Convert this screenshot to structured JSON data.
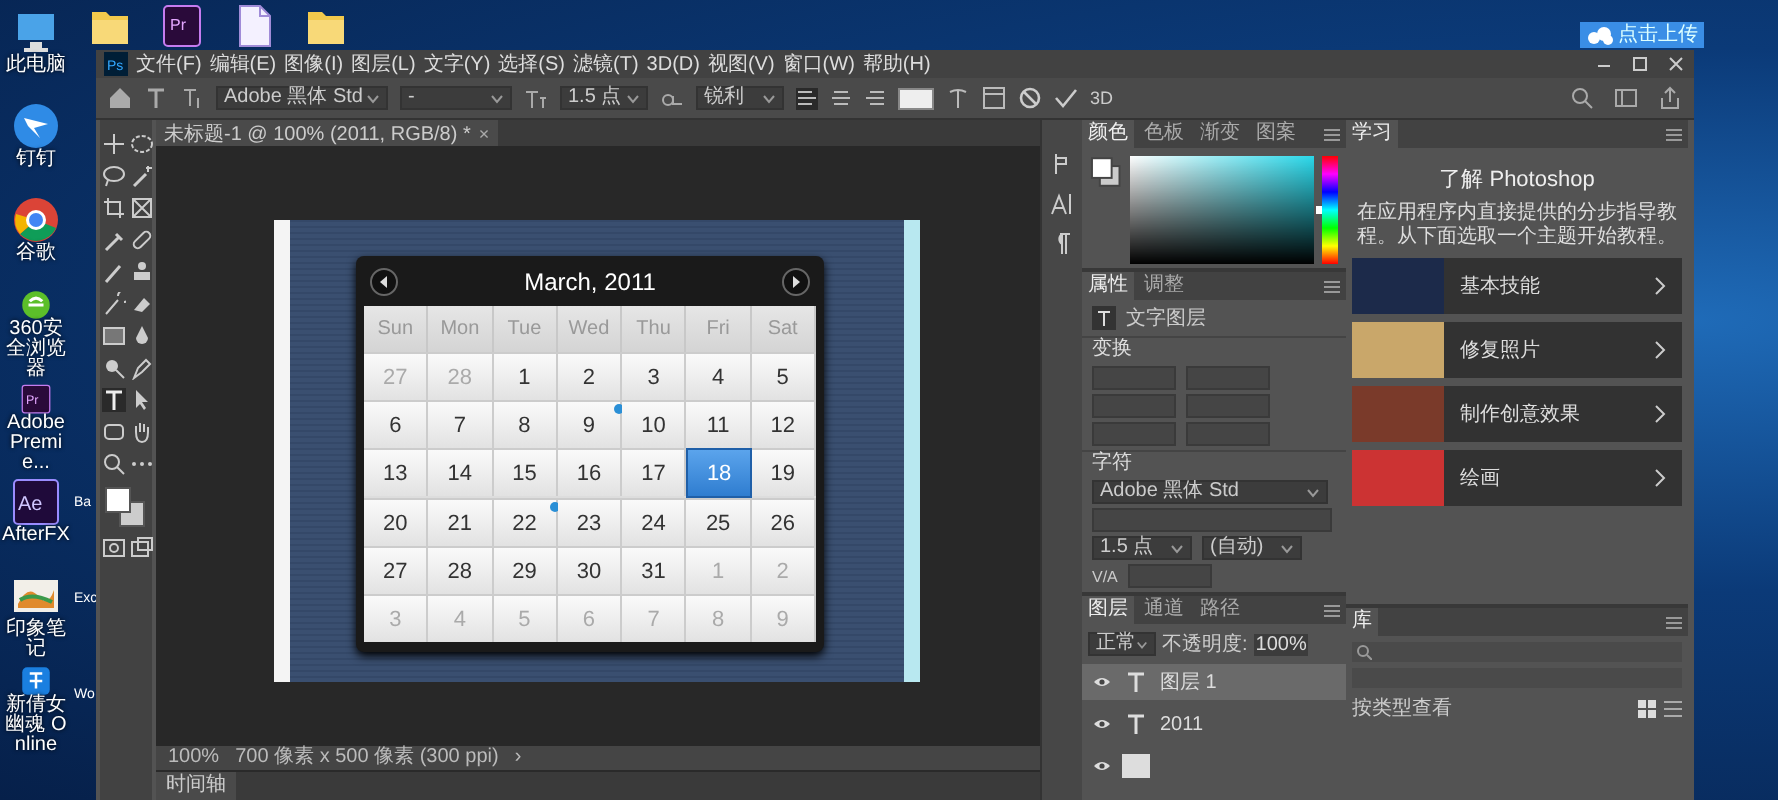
{
  "desktop": {
    "icons": [
      {
        "kind": "pc",
        "label": "此电脑"
      },
      {
        "kind": "dingtalk",
        "label": "钉钉"
      },
      {
        "kind": "chrome",
        "label": "谷歌"
      },
      {
        "kind": "browser360",
        "label": "360安全浏览器"
      },
      {
        "kind": "pr",
        "logo": "Pr",
        "label": "Adobe Premie..."
      },
      {
        "kind": "ae",
        "logo": "Ae",
        "label": "AfterFX"
      },
      {
        "kind": "notes",
        "label": "印象笔记"
      },
      {
        "kind": "game",
        "label": "新倩女幽魂 Online"
      }
    ],
    "partial_icons": [
      {
        "label": "Ba"
      },
      {
        "label": "Exc"
      },
      {
        "label": "Wo"
      }
    ],
    "top_icons": [
      {
        "kind": "folder"
      },
      {
        "kind": "prfile",
        "logo": "Pr"
      },
      {
        "kind": "document"
      },
      {
        "kind": "folder"
      }
    ],
    "upload_button": {
      "label": "点击上传"
    }
  },
  "photoshop": {
    "logo": "Ps",
    "menu": [
      "文件(F)",
      "编辑(E)",
      "图像(I)",
      "图层(L)",
      "文字(Y)",
      "选择(S)",
      "滤镜(T)",
      "3D(D)",
      "视图(V)",
      "窗口(W)",
      "帮助(H)"
    ],
    "options": {
      "font": "Adobe 黑体 Std",
      "style": "-",
      "size": "1.5 点",
      "antialias": "锐利",
      "three_d": "3D"
    },
    "document_tab": {
      "title": "未标题-1 @ 100% (2011, RGB/8) *",
      "close": "×"
    },
    "calendar": {
      "title": "March, 2011",
      "weekdays": [
        "Sun",
        "Mon",
        "Tue",
        "Wed",
        "Thu",
        "Fri",
        "Sat"
      ],
      "weeks": [
        [
          {
            "day": "27",
            "muted": true,
            "selected": false,
            "event": false
          },
          {
            "day": "28",
            "muted": true,
            "selected": false,
            "event": false
          },
          {
            "day": "1",
            "muted": false,
            "selected": false,
            "event": false
          },
          {
            "day": "2",
            "muted": false,
            "selected": false,
            "event": false
          },
          {
            "day": "3",
            "muted": false,
            "selected": false,
            "event": false
          },
          {
            "day": "4",
            "muted": false,
            "selected": false,
            "event": false
          },
          {
            "day": "5",
            "muted": false,
            "selected": false,
            "event": false
          }
        ],
        [
          {
            "day": "6",
            "muted": false,
            "selected": false,
            "event": false
          },
          {
            "day": "7",
            "muted": false,
            "selected": false,
            "event": false
          },
          {
            "day": "8",
            "muted": false,
            "selected": false,
            "event": false
          },
          {
            "day": "9",
            "muted": false,
            "selected": false,
            "event": true
          },
          {
            "day": "10",
            "muted": false,
            "selected": false,
            "event": false
          },
          {
            "day": "11",
            "muted": false,
            "selected": false,
            "event": false
          },
          {
            "day": "12",
            "muted": false,
            "selected": false,
            "event": false
          }
        ],
        [
          {
            "day": "13",
            "muted": false,
            "selected": false,
            "event": false
          },
          {
            "day": "14",
            "muted": false,
            "selected": false,
            "event": false
          },
          {
            "day": "15",
            "muted": false,
            "selected": false,
            "event": false
          },
          {
            "day": "16",
            "muted": false,
            "selected": false,
            "event": false
          },
          {
            "day": "17",
            "muted": false,
            "selected": false,
            "event": false
          },
          {
            "day": "18",
            "muted": false,
            "selected": true,
            "event": false
          },
          {
            "day": "19",
            "muted": false,
            "selected": false,
            "event": false
          }
        ],
        [
          {
            "day": "20",
            "muted": false,
            "selected": false,
            "event": false
          },
          {
            "day": "21",
            "muted": false,
            "selected": false,
            "event": false
          },
          {
            "day": "22",
            "muted": false,
            "selected": false,
            "event": true
          },
          {
            "day": "23",
            "muted": false,
            "selected": false,
            "event": false
          },
          {
            "day": "24",
            "muted": false,
            "selected": false,
            "event": false
          },
          {
            "day": "25",
            "muted": false,
            "selected": false,
            "event": false
          },
          {
            "day": "26",
            "muted": false,
            "selected": false,
            "event": false
          }
        ],
        [
          {
            "day": "27",
            "muted": false,
            "selected": false,
            "event": false
          },
          {
            "day": "28",
            "muted": false,
            "selected": false,
            "event": false
          },
          {
            "day": "29",
            "muted": false,
            "selected": false,
            "event": false
          },
          {
            "day": "30",
            "muted": false,
            "selected": false,
            "event": false
          },
          {
            "day": "31",
            "muted": false,
            "selected": false,
            "event": false
          },
          {
            "day": "1",
            "muted": true,
            "selected": false,
            "event": false
          },
          {
            "day": "2",
            "muted": true,
            "selected": false,
            "event": false
          }
        ],
        [
          {
            "day": "3",
            "muted": true,
            "selected": false,
            "event": false
          },
          {
            "day": "4",
            "muted": true,
            "selected": false,
            "event": false
          },
          {
            "day": "5",
            "muted": true,
            "selected": false,
            "event": false
          },
          {
            "day": "6",
            "muted": true,
            "selected": false,
            "event": false
          },
          {
            "day": "7",
            "muted": true,
            "selected": false,
            "event": false
          },
          {
            "day": "8",
            "muted": true,
            "selected": false,
            "event": false
          },
          {
            "day": "9",
            "muted": true,
            "selected": false,
            "event": false
          }
        ]
      ]
    },
    "status": {
      "zoom": "100%",
      "size": "700 像素 x 500 像素 (300 ppi)",
      "arrow": "›"
    },
    "timeline_tab": "时间轴",
    "color_panel": {
      "tabs": [
        {
          "label": "颜色",
          "selected": true
        },
        {
          "label": "色板",
          "selected": false
        },
        {
          "label": "渐变",
          "selected": false
        },
        {
          "label": "图案",
          "selected": false
        }
      ],
      "hue_slider": {
        "level": 0.5
      }
    },
    "properties": {
      "tabs": [
        {
          "label": "属性",
          "selected": true
        },
        {
          "label": "调整",
          "selected": false
        }
      ],
      "layer_type": "文字图层",
      "transform": "变换",
      "character": "字符",
      "font": "Adobe 黑体 Std",
      "size": "1.5 点",
      "leading": "(自动)",
      "tracking": "V/A"
    },
    "layers": {
      "tabs": [
        {
          "label": "图层",
          "selected": true
        },
        {
          "label": "通道",
          "selected": false
        },
        {
          "label": "路径",
          "selected": false
        }
      ],
      "blend": "正常",
      "opacity_label": "不透明度:",
      "opacity": "100%",
      "items": [
        {
          "kind": "text",
          "name": "图层 1",
          "selected": true
        },
        {
          "kind": "text",
          "name": "2011",
          "selected": false
        },
        {
          "kind": "image",
          "selected": false
        }
      ]
    },
    "learn": {
      "tab": "学习",
      "title": "了解 Photoshop",
      "description": "在应用程序内直接提供的分步指导教程。从下面选取一个主题开始教程。",
      "items": [
        "基本技能",
        "修复照片",
        "制作创意效果",
        "绘画"
      ]
    },
    "library": {
      "tab": "库",
      "view_label": "按类型查看"
    }
  }
}
